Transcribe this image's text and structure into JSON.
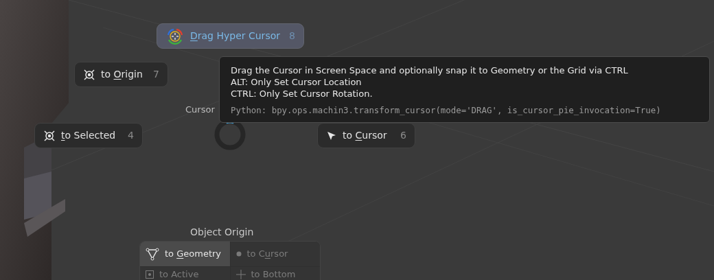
{
  "pie_menu": {
    "items": [
      {
        "key": "D",
        "suffix": "rag Hyper Cursor",
        "number": "8",
        "selected": true
      },
      {
        "prefix": "to ",
        "key": "O",
        "suffix": "rigin",
        "number": "7",
        "selected": false
      },
      {
        "key": "t",
        "suffix": "o Selected",
        "number": "4",
        "selected": false
      },
      {
        "prefix": "to ",
        "key": "C",
        "suffix": "ursor",
        "number": "6",
        "selected": false
      }
    ],
    "center_label": "Cursor"
  },
  "tooltip": {
    "lines": [
      "Drag the Cursor in Screen Space and optionally snap it to Geometry or the Grid via CTRL",
      "ALT: Only Set Cursor Location",
      "CTRL: Only Set Cursor Rotation."
    ],
    "python": "Python: bpy.ops.machin3.transform_cursor(mode='DRAG', is_cursor_pie_invocation=True)"
  },
  "object_origin": {
    "title": "Object Origin",
    "items": [
      {
        "prefix": "to ",
        "key": "G",
        "suffix": "eometry",
        "disabled": false
      },
      {
        "prefix": "to C",
        "key": "u",
        "suffix": "rsor",
        "disabled": true
      },
      {
        "prefix": "to Active",
        "disabled": true
      },
      {
        "prefix": "to Bottom",
        "disabled": true
      }
    ]
  }
}
